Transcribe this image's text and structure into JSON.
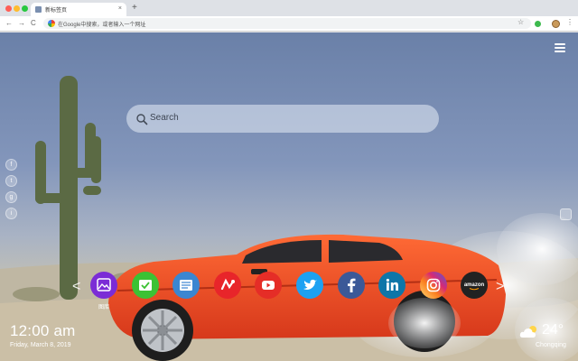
{
  "browser": {
    "tab_title": "新标签页",
    "tab_close": "×",
    "new_tab": "+",
    "nav_back": "←",
    "nav_forward": "→",
    "nav_reload": "C",
    "omnibox_text": "在Google中搜索，或者输入一个网址",
    "bookmark_star": "☆",
    "menu": "⋮"
  },
  "search": {
    "placeholder": "Search"
  },
  "social_icons": [
    "f",
    "t",
    "g",
    "i"
  ],
  "apps": [
    {
      "name": "gallery",
      "label": "图库",
      "color": "#7b2cd6"
    },
    {
      "name": "tasks",
      "label": "",
      "color": "#3cc234"
    },
    {
      "name": "news",
      "label": "",
      "color": "#3b86d1"
    },
    {
      "name": "games",
      "label": "",
      "color": "#e8252a"
    },
    {
      "name": "youtube",
      "label": "",
      "color": "#e52d27"
    },
    {
      "name": "twitter",
      "label": "",
      "color": "#1da1f2"
    },
    {
      "name": "facebook",
      "label": "",
      "color": "#3b5998"
    },
    {
      "name": "linkedin",
      "label": "",
      "color": "#0e76a8"
    },
    {
      "name": "instagram",
      "label": "",
      "color": "#d6249f"
    },
    {
      "name": "amazon",
      "label": "amazon",
      "color": "#222222"
    }
  ],
  "carousel": {
    "prev": "<",
    "next": ">"
  },
  "clock": {
    "time": "12:00 am",
    "date": "Friday, March 8, 2019"
  },
  "weather": {
    "temperature": "24°",
    "city": "Chongqing"
  },
  "colors": {
    "car": "#e8461f",
    "sky": "#6a80a8"
  }
}
